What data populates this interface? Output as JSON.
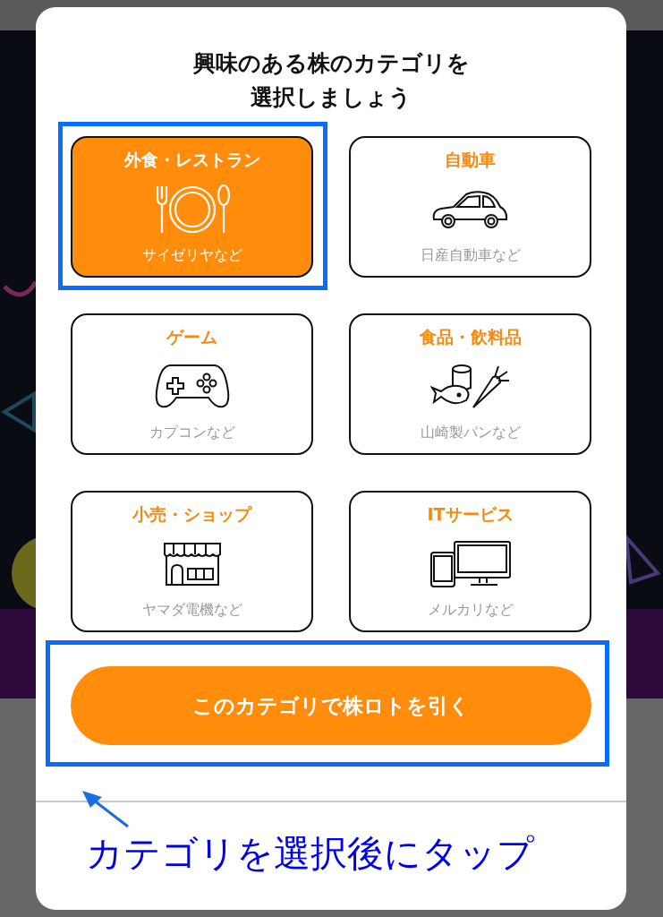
{
  "dialog": {
    "title_lines": [
      "興味のある株のカテゴリを",
      "選択しましょう"
    ],
    "categories": [
      {
        "name": "外食・レストラン",
        "example": "サイゼリヤなど",
        "selected": true,
        "annotated": true
      },
      {
        "name": "自動車",
        "example": "日産自動車など",
        "selected": false,
        "annotated": false
      },
      {
        "name": "ゲーム",
        "example": "カプコンなど",
        "selected": false,
        "annotated": false
      },
      {
        "name": "食品・飲料品",
        "example": "山崎製パンなど",
        "selected": false,
        "annotated": false
      },
      {
        "name": "小売・ショップ",
        "example": "ヤマダ電機など",
        "selected": false,
        "annotated": false
      },
      {
        "name": "ITサービス",
        "example": "メルカリなど",
        "selected": false,
        "annotated": false
      }
    ],
    "draw_button": {
      "label": "このカテゴリで株ロトを引く",
      "annotated": true
    }
  },
  "annotation": {
    "text": "カテゴリを選択後にタップ"
  }
}
